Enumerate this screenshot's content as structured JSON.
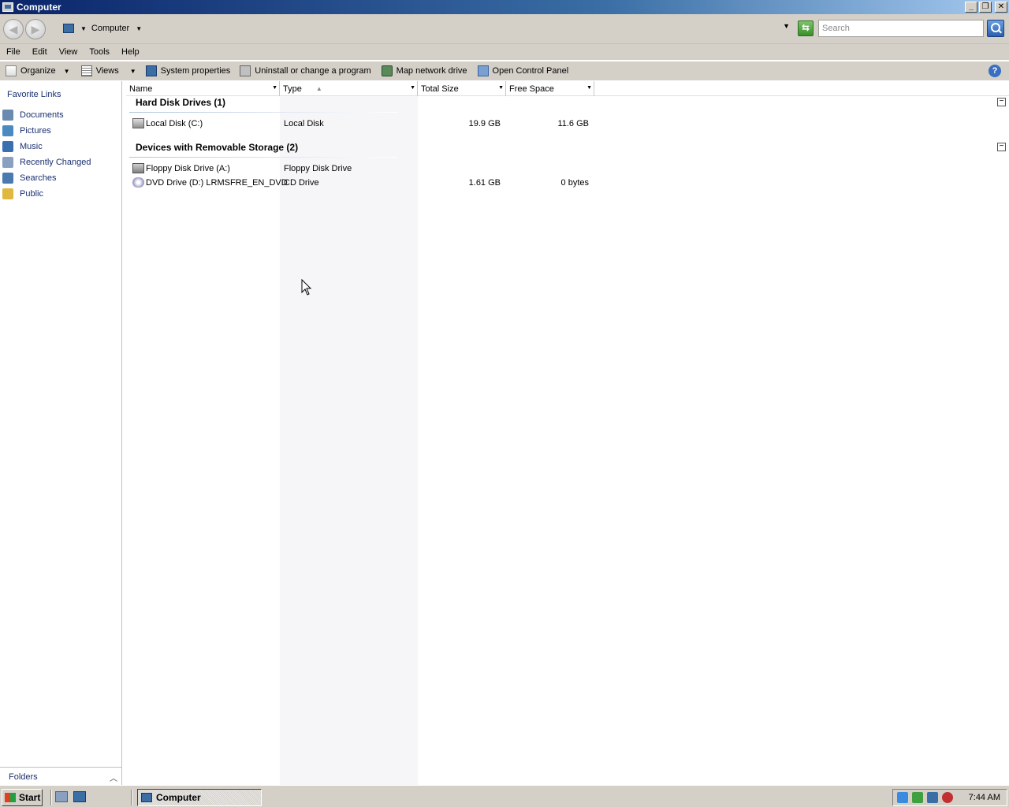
{
  "window": {
    "title": "Computer"
  },
  "address": {
    "location": "Computer",
    "search_placeholder": "Search"
  },
  "menu": [
    "File",
    "Edit",
    "View",
    "Tools",
    "Help"
  ],
  "toolbar": {
    "organize": "Organize",
    "views": "Views",
    "system_properties": "System properties",
    "uninstall": "Uninstall or change a program",
    "map_drive": "Map network drive",
    "control_panel": "Open Control Panel",
    "help": "?"
  },
  "nav": {
    "title": "Favorite Links",
    "items": [
      "Documents",
      "Pictures",
      "Music",
      "Recently Changed",
      "Searches",
      "Public"
    ],
    "folders": "Folders"
  },
  "columns": {
    "name": "Name",
    "type": "Type",
    "total": "Total Size",
    "free": "Free Space"
  },
  "groups": {
    "hdd": {
      "title": "Hard Disk Drives (1)",
      "rows": [
        {
          "name": "Local Disk (C:)",
          "type": "Local Disk",
          "total": "19.9 GB",
          "free": "11.6 GB"
        }
      ]
    },
    "removable": {
      "title": "Devices with Removable Storage (2)",
      "rows": [
        {
          "name": "Floppy Disk Drive (A:)",
          "type": "Floppy Disk Drive",
          "total": "",
          "free": ""
        },
        {
          "name": "DVD Drive (D:) LRMSFRE_EN_DVD",
          "type": "CD Drive",
          "total": "1.61 GB",
          "free": "0 bytes"
        }
      ]
    }
  },
  "taskbar": {
    "start": "Start",
    "task": "Computer",
    "clock": "7:44 AM"
  }
}
